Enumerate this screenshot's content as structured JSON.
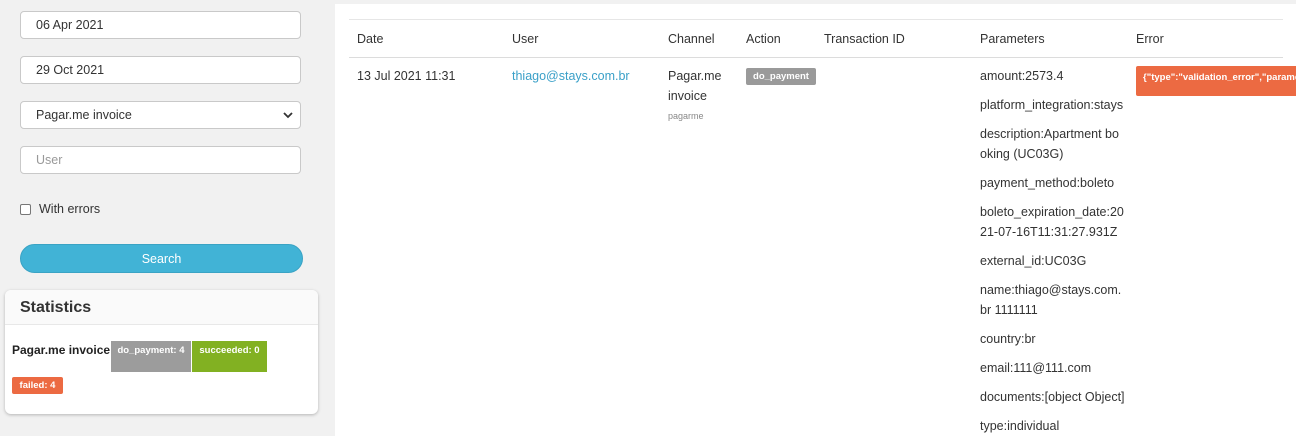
{
  "filters": {
    "start_date": "06 Apr 2021",
    "end_date": "29 Oct 2021",
    "channel_selected": "Pagar.me invoice",
    "user_placeholder": "User",
    "with_errors_label": "With errors",
    "search_label": "Search"
  },
  "statistics": {
    "title": "Statistics",
    "channel_label": "Pagar.me invoice:",
    "badges": {
      "do_payment": "do_payment: 4",
      "succeeded": "succeeded: 0",
      "failed": "failed: 4"
    }
  },
  "table": {
    "headers": [
      "Date",
      "User",
      "Channel",
      "Action",
      "Transaction ID",
      "Parameters",
      "Error"
    ],
    "row": {
      "date": "13 Jul 2021 11:31",
      "user": "thiago@stays.com.br",
      "channel_line1": "Pagar.me",
      "channel_line2": "invoice",
      "channel_sub": "pagarme",
      "action": "do_payment",
      "transaction_id": "",
      "parameters": [
        "amount:2573.4",
        "platform_integration:stays",
        "description:Apartment booking (UC03G)",
        "payment_method:boleto",
        "boleto_expiration_date:2021-07-16T11:31:27.931Z",
        "external_id:UC03G",
        "name:thiago@stays.com.br 1111111",
        "country:br",
        "email:111@111.com",
        "documents:[object Object]",
        "type:individual"
      ],
      "error": "{\"type\":\"validation_error\",\"parameters\""
    }
  },
  "colors": {
    "accent": "#41b3d6",
    "link": "#3aa0c8",
    "failed": "#ec6a42",
    "succeeded": "#82b122",
    "neutral_badge": "#9c9c9c"
  }
}
